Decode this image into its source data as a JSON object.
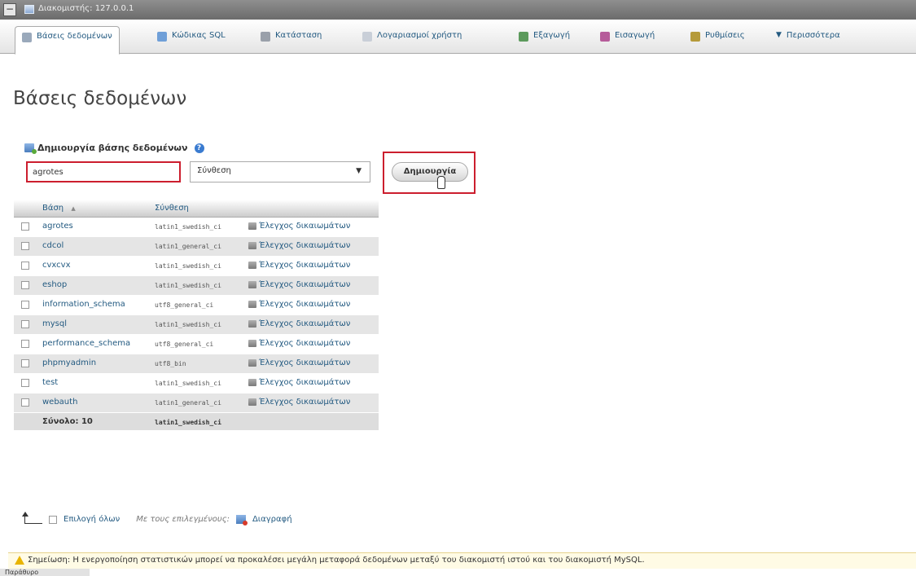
{
  "server": {
    "label": "Διακομιστής: 127.0.0.1"
  },
  "tabs": [
    {
      "label": "Βάσεις δεδομένων",
      "active": true
    },
    {
      "label": "Κώδικας SQL"
    },
    {
      "label": "Κατάσταση"
    },
    {
      "label": "Λογαριασμοί χρήστη"
    },
    {
      "label": "Εξαγωγή"
    },
    {
      "label": "Εισαγωγή"
    },
    {
      "label": "Ρυθμίσεις"
    },
    {
      "label": "Περισσότερα"
    }
  ],
  "page": {
    "title": "Βάσεις δεδομένων"
  },
  "create": {
    "heading": "Δημιουργία βάσης δεδομένων",
    "db_name_value": "agrotes",
    "collation_selected": "Σύνθεση",
    "button_label": "Δημιουργία"
  },
  "table": {
    "headers": {
      "db": "Βάση",
      "sort_indicator": "▲",
      "collation": "Σύνθεση"
    },
    "rows": [
      {
        "name": "agrotes",
        "collation": "latin1_swedish_ci",
        "priv": "Έλεγχος δικαιωμάτων"
      },
      {
        "name": "cdcol",
        "collation": "latin1_general_ci",
        "priv": "Έλεγχος δικαιωμάτων"
      },
      {
        "name": "cvxcvx",
        "collation": "latin1_swedish_ci",
        "priv": "Έλεγχος δικαιωμάτων"
      },
      {
        "name": "eshop",
        "collation": "latin1_swedish_ci",
        "priv": "Έλεγχος δικαιωμάτων"
      },
      {
        "name": "information_schema",
        "collation": "utf8_general_ci",
        "priv": "Έλεγχος δικαιωμάτων"
      },
      {
        "name": "mysql",
        "collation": "latin1_swedish_ci",
        "priv": "Έλεγχος δικαιωμάτων"
      },
      {
        "name": "performance_schema",
        "collation": "utf8_general_ci",
        "priv": "Έλεγχος δικαιωμάτων"
      },
      {
        "name": "phpmyadmin",
        "collation": "utf8_bin",
        "priv": "Έλεγχος δικαιωμάτων"
      },
      {
        "name": "test",
        "collation": "latin1_swedish_ci",
        "priv": "Έλεγχος δικαιωμάτων"
      },
      {
        "name": "webauth",
        "collation": "latin1_general_ci",
        "priv": "Έλεγχος δικαιωμάτων"
      }
    ],
    "footer": {
      "total": "Σύνολο: 10",
      "collation": "latin1_swedish_ci"
    }
  },
  "bulk": {
    "select_all": "Επιλογή όλων",
    "with_selected": "Με τους επιλεγμένους:",
    "delete": "Διαγραφή"
  },
  "notice": "Σημείωση: Η ενεργοποίηση στατιστικών μπορεί να προκαλέσει μεγάλη μεταφορά δεδομένων μεταξύ του διακομιστή ιστού και του διακομιστή MySQL.",
  "console": "Παράθυρο"
}
